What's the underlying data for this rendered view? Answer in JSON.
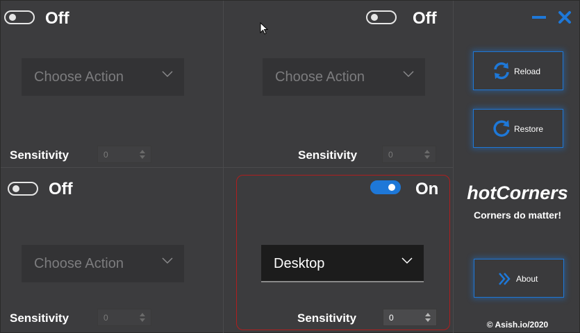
{
  "corners": {
    "top_left": {
      "state": "Off",
      "action": "Choose Action",
      "sensitivity_label": "Sensitivity",
      "sensitivity": "0"
    },
    "top_right": {
      "state": "Off",
      "action": "Choose Action",
      "sensitivity_label": "Sensitivity",
      "sensitivity": "0"
    },
    "bottom_left": {
      "state": "Off",
      "action": "Choose Action",
      "sensitivity_label": "Sensitivity",
      "sensitivity": "0"
    },
    "bottom_right": {
      "state": "On",
      "action": "Desktop",
      "sensitivity_label": "Sensitivity",
      "sensitivity": "0"
    }
  },
  "sidebar": {
    "reload_label": "Reload",
    "restore_label": "Restore",
    "about_label": "About",
    "brand": "hotCorners",
    "tagline": "Corners do matter!",
    "copyright": "© Asish.io/2020"
  },
  "icons": {
    "minimize": "minimize-icon",
    "close": "close-icon",
    "reload": "reload-icon",
    "restore": "restore-icon",
    "about": "double-chevron-right-icon",
    "dropdown": "chevron-down-icon"
  },
  "colors": {
    "accent": "#1e78d8",
    "active_border": "#b01e1e",
    "background": "#3c3c3e"
  }
}
